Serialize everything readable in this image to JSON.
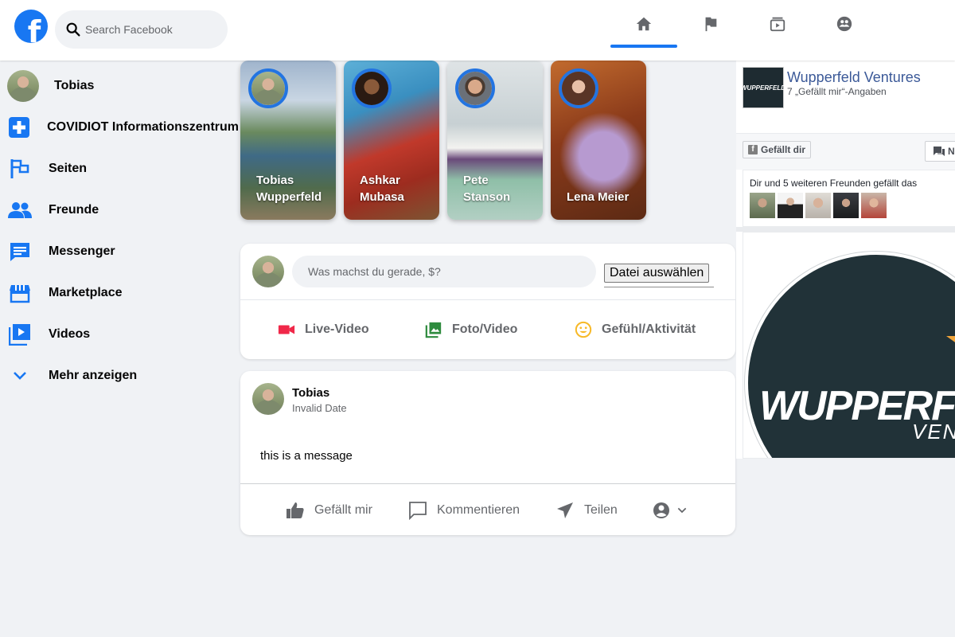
{
  "header": {
    "logo": "f",
    "search_placeholder": "Search Facebook",
    "nav": [
      {
        "name": "home-icon",
        "active": true
      },
      {
        "name": "flag-icon",
        "active": false
      },
      {
        "name": "watch-icon",
        "active": false
      },
      {
        "name": "groups-icon",
        "active": false
      }
    ]
  },
  "sidebar": {
    "items": [
      {
        "label": "Tobias",
        "icon": "avatar"
      },
      {
        "label": "COVIDIOT Informationszentrum",
        "icon": "plus-icon"
      },
      {
        "label": "Seiten",
        "icon": "flag-icon"
      },
      {
        "label": "Freunde",
        "icon": "friends-icon"
      },
      {
        "label": "Messenger",
        "icon": "messenger-icon"
      },
      {
        "label": "Marketplace",
        "icon": "shop-icon"
      },
      {
        "label": "Videos",
        "icon": "video-icon"
      },
      {
        "label": "Mehr anzeigen",
        "icon": "chevron-down-icon"
      }
    ]
  },
  "stories": [
    {
      "name": "Tobias Wupperfeld"
    },
    {
      "name": "Ashkar Mubasa"
    },
    {
      "name": "Pete Stanson"
    },
    {
      "name": "Lena Meier"
    }
  ],
  "composer": {
    "placeholder": "Was machst du gerade, $?",
    "file_button": "Datei auswählen",
    "actions": [
      {
        "label": "Live-Video",
        "icon": "live-video-icon",
        "color": "#f02849"
      },
      {
        "label": "Foto/Video",
        "icon": "photo-icon",
        "color": "#45bd62"
      },
      {
        "label": "Gefühl/Aktivität",
        "icon": "smiley-icon",
        "color": "#f7b928"
      }
    ]
  },
  "post": {
    "author": "Tobias",
    "date": "Invalid Date",
    "message": "this is a message",
    "actions": {
      "like": "Gefällt mir",
      "comment": "Kommentieren",
      "share": "Teilen"
    }
  },
  "page_plugin": {
    "name": "Wupperfeld Ventures",
    "likes": "7 „Gefällt mir“-Angaben",
    "like_button": "Gefällt dir",
    "message_button": "N",
    "friends_text": "Dir und 5 weiteren Freunden gefällt das",
    "thumb_text": "WUPPERFELD",
    "cover_brand": "WUPPERFELD",
    "cover_sub": "VENTURES"
  },
  "colors": {
    "accent": "#1877f2",
    "page_bg": "#f0f2f5"
  }
}
